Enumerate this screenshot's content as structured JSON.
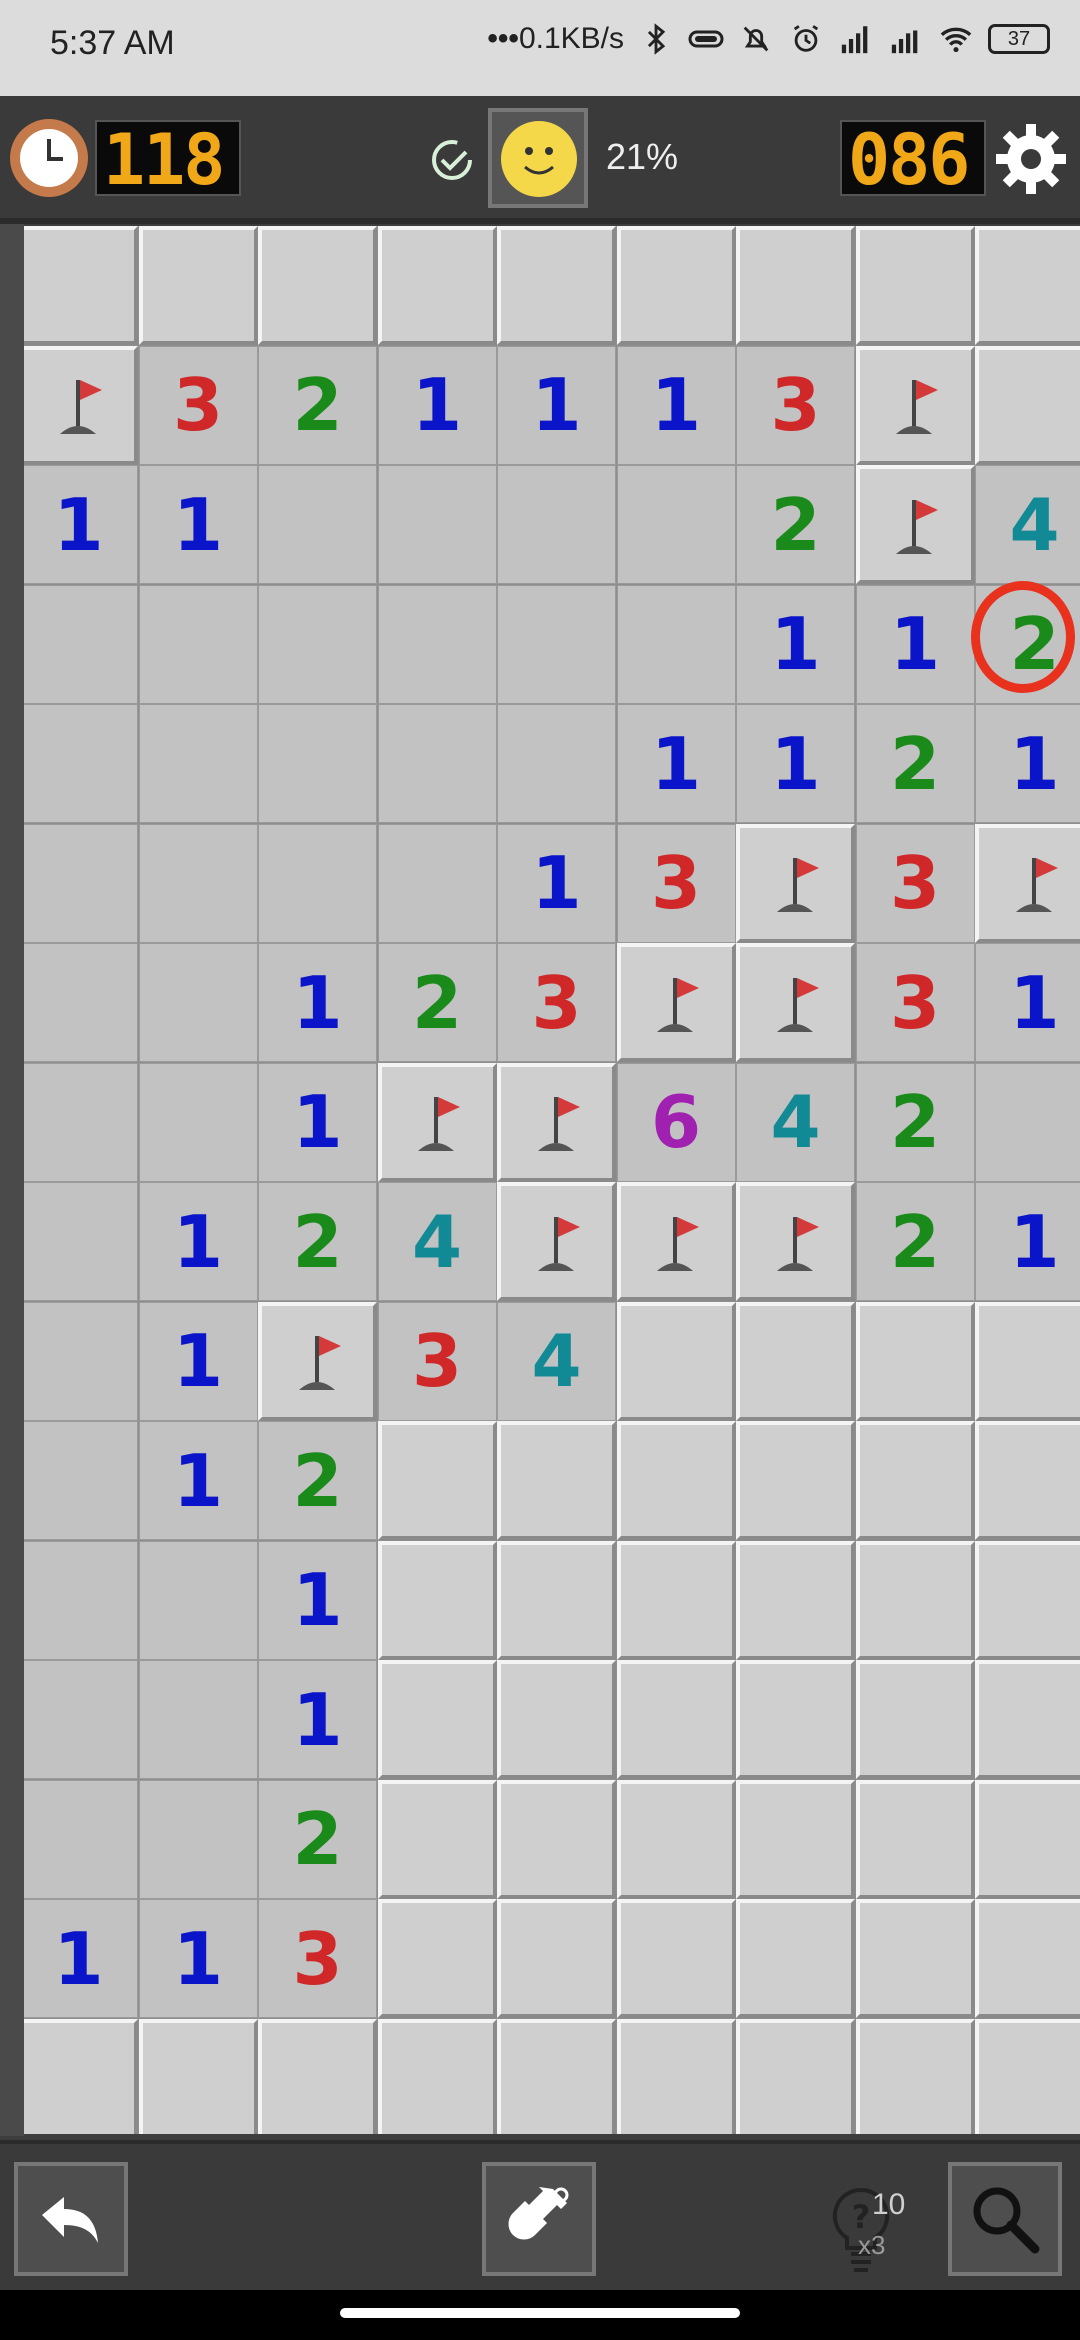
{
  "status_bar": {
    "time": "5:37 AM",
    "network_speed": "0.1KB/s",
    "battery": "37"
  },
  "game_bar": {
    "timer": "118",
    "progress": "21%",
    "mines_left": "086"
  },
  "board": {
    "rows": [
      [
        "c",
        "c",
        "c",
        "c",
        "c",
        "c",
        "c",
        "c",
        "c"
      ],
      [
        "F",
        "3",
        "2",
        "1",
        "1",
        "1",
        "3",
        "F",
        "c"
      ],
      [
        "1",
        "1",
        "",
        "",
        "",
        "",
        "2",
        "F",
        "4"
      ],
      [
        "",
        "",
        "",
        "",
        "",
        "",
        "1",
        "1",
        "2"
      ],
      [
        "",
        "",
        "",
        "",
        "",
        "1",
        "1",
        "2",
        "1"
      ],
      [
        "",
        "",
        "",
        "",
        "1",
        "3",
        "F",
        "3",
        "F"
      ],
      [
        "",
        "",
        "1",
        "2",
        "3",
        "F",
        "F",
        "3",
        "1"
      ],
      [
        "",
        "",
        "1",
        "F",
        "F",
        "6",
        "4",
        "2",
        ""
      ],
      [
        "",
        "1",
        "2",
        "4",
        "F",
        "F",
        "F",
        "2",
        "1"
      ],
      [
        "",
        "1",
        "F",
        "3",
        "4",
        "c",
        "c",
        "c",
        "c"
      ],
      [
        "",
        "1",
        "2",
        "c",
        "c",
        "c",
        "c",
        "c",
        "c"
      ],
      [
        "",
        "",
        "1",
        "c",
        "c",
        "c",
        "c",
        "c",
        "c"
      ],
      [
        "",
        "",
        "1",
        "c",
        "c",
        "c",
        "c",
        "c",
        "c"
      ],
      [
        "",
        "",
        "2",
        "c",
        "c",
        "c",
        "c",
        "c",
        "c"
      ],
      [
        "1",
        "1",
        "3",
        "c",
        "c",
        "c",
        "c",
        "c",
        "c"
      ],
      [
        "c",
        "c",
        "c",
        "c",
        "c",
        "c",
        "c",
        "c",
        "c"
      ]
    ],
    "highlight_cell": {
      "row": 3,
      "col": 8
    }
  },
  "bottom_bar": {
    "hint_count": "10",
    "hint_multiplier": "x3"
  },
  "icons": {
    "clock": "clock-icon",
    "check": "check-icon",
    "face": "smiley-icon",
    "settings": "gear-icon",
    "undo": "undo-arrow-icon",
    "dig": "shovel-icon",
    "hint": "lightbulb-question-icon",
    "zoom": "magnifier-icon",
    "flag": "flag-icon"
  },
  "colors": {
    "lcd_digits": "#f0a818",
    "n1": "#0a14c8",
    "n2": "#1a8a1a",
    "n3": "#d02828",
    "n4": "#128a96",
    "n6": "#a020b0",
    "flag": "#d43a3a",
    "highlight": "#e8321e"
  }
}
